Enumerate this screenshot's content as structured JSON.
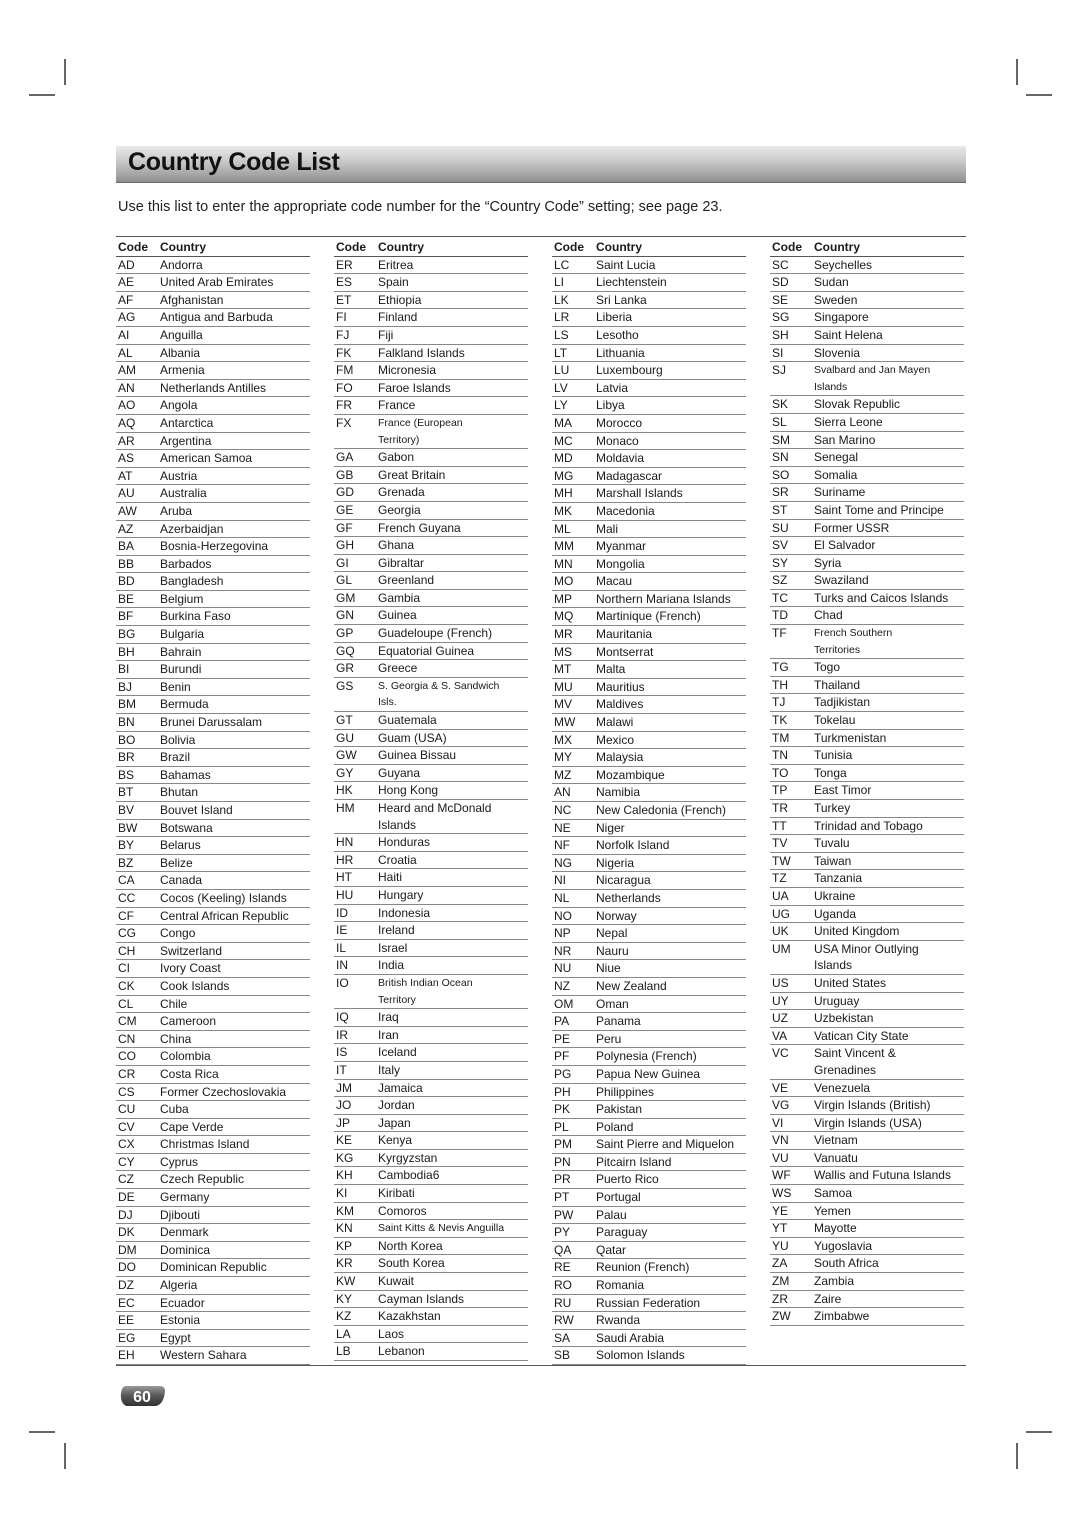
{
  "title": "Country Code List",
  "intro": "Use this list to enter the appropriate code number for the “Country Code” setting; see page 23.",
  "headers": {
    "code": "Code",
    "country": "Country"
  },
  "page_number": "60",
  "columns": [
    [
      [
        "AD",
        "Andorra"
      ],
      [
        "AE",
        "United Arab Emirates"
      ],
      [
        "AF",
        "Afghanistan"
      ],
      [
        "AG",
        "Antigua and Barbuda"
      ],
      [
        "AI",
        "Anguilla"
      ],
      [
        "AL",
        "Albania"
      ],
      [
        "AM",
        "Armenia"
      ],
      [
        "AN",
        "Netherlands Antilles"
      ],
      [
        "AO",
        "Angola"
      ],
      [
        "AQ",
        "Antarctica"
      ],
      [
        "AR",
        "Argentina"
      ],
      [
        "AS",
        "American Samoa"
      ],
      [
        "AT",
        "Austria"
      ],
      [
        "AU",
        "Australia"
      ],
      [
        "AW",
        "Aruba"
      ],
      [
        "AZ",
        "Azerbaidjan"
      ],
      [
        "BA",
        "Bosnia-Herzegovina"
      ],
      [
        "BB",
        "Barbados"
      ],
      [
        "BD",
        "Bangladesh"
      ],
      [
        "BE",
        "Belgium"
      ],
      [
        "BF",
        "Burkina Faso"
      ],
      [
        "BG",
        "Bulgaria"
      ],
      [
        "BH",
        "Bahrain"
      ],
      [
        "BI",
        "Burundi"
      ],
      [
        "BJ",
        "Benin"
      ],
      [
        "BM",
        "Bermuda"
      ],
      [
        "BN",
        "Brunei Darussalam"
      ],
      [
        "BO",
        "Bolivia"
      ],
      [
        "BR",
        "Brazil"
      ],
      [
        "BS",
        "Bahamas"
      ],
      [
        "BT",
        "Bhutan"
      ],
      [
        "BV",
        "Bouvet Island"
      ],
      [
        "BW",
        "Botswana"
      ],
      [
        "BY",
        "Belarus"
      ],
      [
        "BZ",
        "Belize"
      ],
      [
        "CA",
        "Canada"
      ],
      [
        "CC",
        "Cocos (Keeling) Islands"
      ],
      [
        "CF",
        "Central African Republic"
      ],
      [
        "CG",
        "Congo"
      ],
      [
        "CH",
        "Switzerland"
      ],
      [
        "CI",
        "Ivory Coast"
      ],
      [
        "CK",
        "Cook Islands"
      ],
      [
        "CL",
        "Chile"
      ],
      [
        "CM",
        "Cameroon"
      ],
      [
        "CN",
        "China"
      ],
      [
        "CO",
        "Colombia"
      ],
      [
        "CR",
        "Costa Rica"
      ],
      [
        "CS",
        "Former Czechoslovakia"
      ],
      [
        "CU",
        "Cuba"
      ],
      [
        "CV",
        "Cape Verde"
      ],
      [
        "CX",
        "Christmas Island"
      ],
      [
        "CY",
        "Cyprus"
      ],
      [
        "CZ",
        "Czech Republic"
      ],
      [
        "DE",
        "Germany"
      ],
      [
        "DJ",
        "Djibouti"
      ],
      [
        "DK",
        "Denmark"
      ],
      [
        "DM",
        "Dominica"
      ],
      [
        "DO",
        "Dominican Republic"
      ],
      [
        "DZ",
        "Algeria"
      ],
      [
        "EC",
        "Ecuador"
      ],
      [
        "EE",
        "Estonia"
      ],
      [
        "EG",
        "Egypt"
      ],
      [
        "EH",
        "Western Sahara"
      ]
    ],
    [
      [
        "ER",
        "Eritrea"
      ],
      [
        "ES",
        "Spain"
      ],
      [
        "ET",
        "Ethiopia"
      ],
      [
        "FI",
        "Finland"
      ],
      [
        "FJ",
        "Fiji"
      ],
      [
        "FK",
        "Falkland Islands"
      ],
      [
        "FM",
        "Micronesia"
      ],
      [
        "FO",
        "Faroe Islands"
      ],
      [
        "FR",
        "France"
      ],
      [
        "FX",
        "France (European\nTerritory)"
      ],
      [
        "GA",
        "Gabon"
      ],
      [
        "GB",
        "Great Britain"
      ],
      [
        "GD",
        "Grenada"
      ],
      [
        "GE",
        "Georgia"
      ],
      [
        "GF",
        "French Guyana"
      ],
      [
        "GH",
        "Ghana"
      ],
      [
        "GI",
        "Gibraltar"
      ],
      [
        "GL",
        "Greenland"
      ],
      [
        "GM",
        "Gambia"
      ],
      [
        "GN",
        "Guinea"
      ],
      [
        "GP",
        "Guadeloupe (French)"
      ],
      [
        "GQ",
        "Equatorial Guinea"
      ],
      [
        "GR",
        "Greece"
      ],
      [
        "GS",
        "S. Georgia & S. Sandwich\nIsls."
      ],
      [
        "GT",
        "Guatemala"
      ],
      [
        "GU",
        "Guam (USA)"
      ],
      [
        "GW",
        "Guinea Bissau"
      ],
      [
        "GY",
        "Guyana"
      ],
      [
        "HK",
        "Hong Kong"
      ],
      [
        "HM",
        "Heard and McDonald\nIslands"
      ],
      [
        "HN",
        "Honduras"
      ],
      [
        "HR",
        "Croatia"
      ],
      [
        "HT",
        "Haiti"
      ],
      [
        "HU",
        "Hungary"
      ],
      [
        "ID",
        "Indonesia"
      ],
      [
        "IE",
        "Ireland"
      ],
      [
        "IL",
        "Israel"
      ],
      [
        "IN",
        "India"
      ],
      [
        "IO",
        "British Indian Ocean\nTerritory"
      ],
      [
        "IQ",
        "Iraq"
      ],
      [
        "IR",
        "Iran"
      ],
      [
        "IS",
        "Iceland"
      ],
      [
        "IT",
        "Italy"
      ],
      [
        "JM",
        "Jamaica"
      ],
      [
        "JO",
        "Jordan"
      ],
      [
        "JP",
        "Japan"
      ],
      [
        "KE",
        "Kenya"
      ],
      [
        "KG",
        "Kyrgyzstan"
      ],
      [
        "KH",
        "Cambodia6"
      ],
      [
        "KI",
        "Kiribati"
      ],
      [
        "KM",
        "Comoros"
      ],
      [
        "KN",
        "Saint Kitts & Nevis Anguilla"
      ],
      [
        "KP",
        "North Korea"
      ],
      [
        "KR",
        "South Korea"
      ],
      [
        "KW",
        "Kuwait"
      ],
      [
        "KY",
        "Cayman Islands"
      ],
      [
        "KZ",
        "Kazakhstan"
      ],
      [
        "LA",
        "Laos"
      ],
      [
        "LB",
        "Lebanon"
      ]
    ],
    [
      [
        "LC",
        "Saint Lucia"
      ],
      [
        "LI",
        "Liechtenstein"
      ],
      [
        "LK",
        "Sri Lanka"
      ],
      [
        "LR",
        "Liberia"
      ],
      [
        "LS",
        "Lesotho"
      ],
      [
        "LT",
        "Lithuania"
      ],
      [
        "LU",
        "Luxembourg"
      ],
      [
        "LV",
        "Latvia"
      ],
      [
        "LY",
        "Libya"
      ],
      [
        "MA",
        "Morocco"
      ],
      [
        "MC",
        "Monaco"
      ],
      [
        "MD",
        "Moldavia"
      ],
      [
        "MG",
        "Madagascar"
      ],
      [
        "MH",
        "Marshall Islands"
      ],
      [
        "MK",
        "Macedonia"
      ],
      [
        "ML",
        "Mali"
      ],
      [
        "MM",
        "Myanmar"
      ],
      [
        "MN",
        "Mongolia"
      ],
      [
        "MO",
        "Macau"
      ],
      [
        "MP",
        "Northern Mariana Islands"
      ],
      [
        "MQ",
        "Martinique (French)"
      ],
      [
        "MR",
        "Mauritania"
      ],
      [
        "MS",
        "Montserrat"
      ],
      [
        "MT",
        "Malta"
      ],
      [
        "MU",
        "Mauritius"
      ],
      [
        "MV",
        "Maldives"
      ],
      [
        "MW",
        "Malawi"
      ],
      [
        "MX",
        "Mexico"
      ],
      [
        "MY",
        "Malaysia"
      ],
      [
        "MZ",
        "Mozambique"
      ],
      [
        "AN",
        "Namibia"
      ],
      [
        "NC",
        "New Caledonia (French)"
      ],
      [
        "NE",
        "Niger"
      ],
      [
        "NF",
        "Norfolk Island"
      ],
      [
        "NG",
        "Nigeria"
      ],
      [
        "NI",
        "Nicaragua"
      ],
      [
        "NL",
        "Netherlands"
      ],
      [
        "NO",
        "Norway"
      ],
      [
        "NP",
        "Nepal"
      ],
      [
        "NR",
        "Nauru"
      ],
      [
        "NU",
        "Niue"
      ],
      [
        "NZ",
        "New Zealand"
      ],
      [
        "OM",
        "Oman"
      ],
      [
        "PA",
        "Panama"
      ],
      [
        "PE",
        "Peru"
      ],
      [
        "PF",
        "Polynesia (French)"
      ],
      [
        "PG",
        "Papua New Guinea"
      ],
      [
        "PH",
        "Philippines"
      ],
      [
        "PK",
        "Pakistan"
      ],
      [
        "PL",
        "Poland"
      ],
      [
        "PM",
        "Saint Pierre and Miquelon"
      ],
      [
        "PN",
        "Pitcairn Island"
      ],
      [
        "PR",
        "Puerto Rico"
      ],
      [
        "PT",
        "Portugal"
      ],
      [
        "PW",
        "Palau"
      ],
      [
        "PY",
        "Paraguay"
      ],
      [
        "QA",
        "Qatar"
      ],
      [
        "RE",
        "Reunion (French)"
      ],
      [
        "RO",
        "Romania"
      ],
      [
        "RU",
        "Russian Federation"
      ],
      [
        "RW",
        "Rwanda"
      ],
      [
        "SA",
        "Saudi Arabia"
      ],
      [
        "SB",
        "Solomon Islands"
      ]
    ],
    [
      [
        "SC",
        "Seychelles"
      ],
      [
        "SD",
        "Sudan"
      ],
      [
        "SE",
        "Sweden"
      ],
      [
        "SG",
        "Singapore"
      ],
      [
        "SH",
        "Saint Helena"
      ],
      [
        "SI",
        "Slovenia"
      ],
      [
        "SJ",
        "Svalbard and Jan Mayen\nIslands"
      ],
      [
        "SK",
        "Slovak Republic"
      ],
      [
        "SL",
        "Sierra Leone"
      ],
      [
        "SM",
        "San Marino"
      ],
      [
        "SN",
        "Senegal"
      ],
      [
        "SO",
        "Somalia"
      ],
      [
        "SR",
        "Suriname"
      ],
      [
        "ST",
        "Saint Tome and Principe"
      ],
      [
        "SU",
        "Former USSR"
      ],
      [
        "SV",
        "El Salvador"
      ],
      [
        "SY",
        "Syria"
      ],
      [
        "SZ",
        "Swaziland"
      ],
      [
        "TC",
        "Turks and Caicos Islands"
      ],
      [
        "TD",
        "Chad"
      ],
      [
        "TF",
        "French Southern\nTerritories"
      ],
      [
        "TG",
        "Togo"
      ],
      [
        "TH",
        "Thailand"
      ],
      [
        "TJ",
        "Tadjikistan"
      ],
      [
        "TK",
        "Tokelau"
      ],
      [
        "TM",
        "Turkmenistan"
      ],
      [
        "TN",
        "Tunisia"
      ],
      [
        "TO",
        "Tonga"
      ],
      [
        "TP",
        "East Timor"
      ],
      [
        "TR",
        "Turkey"
      ],
      [
        "TT",
        "Trinidad and Tobago"
      ],
      [
        "TV",
        "Tuvalu"
      ],
      [
        "TW",
        "Taiwan"
      ],
      [
        "TZ",
        "Tanzania"
      ],
      [
        "UA",
        "Ukraine"
      ],
      [
        "UG",
        "Uganda"
      ],
      [
        "UK",
        "United Kingdom"
      ],
      [
        "UM",
        "USA Minor Outlying\nIslands"
      ],
      [
        "US",
        "United States"
      ],
      [
        "UY",
        "Uruguay"
      ],
      [
        "UZ",
        "Uzbekistan"
      ],
      [
        "VA",
        "Vatican City State"
      ],
      [
        "VC",
        "Saint Vincent &\nGrenadines"
      ],
      [
        "VE",
        "Venezuela"
      ],
      [
        "VG",
        "Virgin Islands (British)"
      ],
      [
        "VI",
        "Virgin Islands (USA)"
      ],
      [
        "VN",
        "Vietnam"
      ],
      [
        "VU",
        "Vanuatu"
      ],
      [
        "WF",
        "Wallis and Futuna Islands"
      ],
      [
        "WS",
        "Samoa"
      ],
      [
        "YE",
        "Yemen"
      ],
      [
        "YT",
        "Mayotte"
      ],
      [
        "YU",
        "Yugoslavia"
      ],
      [
        "ZA",
        "South Africa"
      ],
      [
        "ZM",
        "Zambia"
      ],
      [
        "ZR",
        "Zaire"
      ],
      [
        "ZW",
        "Zimbabwe"
      ]
    ]
  ]
}
